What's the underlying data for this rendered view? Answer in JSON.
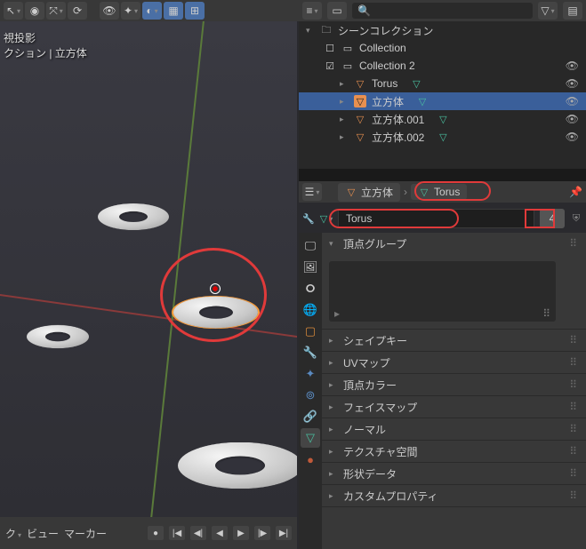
{
  "viewport": {
    "overlay_line1": "視投影",
    "overlay_line2": "クション | 立方体",
    "timeline_view": "ビュー",
    "timeline_marker": "マーカー"
  },
  "outliner": {
    "root": "シーンコレクション",
    "collection1": "Collection",
    "collection2": "Collection 2",
    "items": [
      {
        "name": "Torus"
      },
      {
        "name": "立方体"
      },
      {
        "name": "立方体.001"
      },
      {
        "name": "立方体.002"
      }
    ]
  },
  "properties": {
    "breadcrumb_obj": "立方体",
    "breadcrumb_data": "Torus",
    "data_name": "Torus",
    "users": "4",
    "panels": {
      "vertex_groups": "頂点グループ",
      "shape_keys": "シェイプキー",
      "uv_maps": "UVマップ",
      "vertex_colors": "頂点カラー",
      "face_maps": "フェイスマップ",
      "normals": "ノーマル",
      "tex_space": "テクスチャ空間",
      "geom_data": "形状データ",
      "custom_props": "カスタムプロパティ"
    }
  }
}
